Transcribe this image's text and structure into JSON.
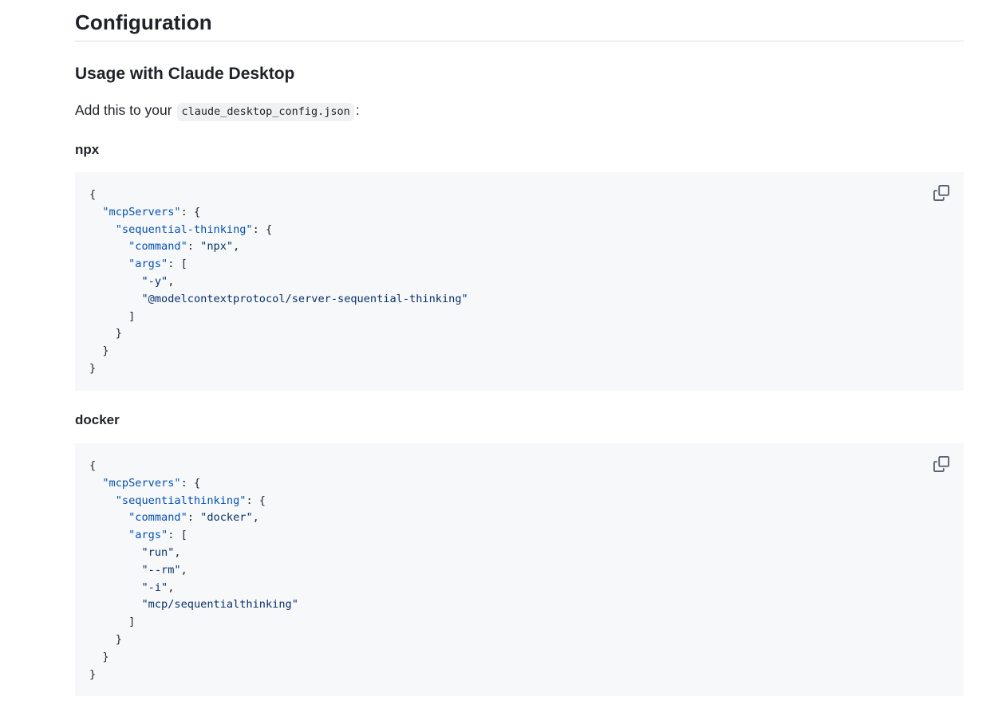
{
  "section": {
    "title": "Configuration"
  },
  "usage": {
    "heading": "Usage with Claude Desktop",
    "intro_prefix": "Add this to your",
    "intro_code": "claude_desktop_config.json",
    "intro_suffix": ":"
  },
  "blocks": [
    {
      "label": "npx",
      "lines": [
        "{",
        "  \"mcpServers\": {",
        "    \"sequential-thinking\": {",
        "      \"command\": \"npx\",",
        "      \"args\": [",
        "        \"-y\",",
        "        \"@modelcontextprotocol/server-sequential-thinking\"",
        "      ]",
        "    }",
        "  }",
        "}"
      ],
      "copy_icon": "copy-icon"
    },
    {
      "label": "docker",
      "lines": [
        "{",
        "  \"mcpServers\": {",
        "    \"sequentialthinking\": {",
        "      \"command\": \"docker\",",
        "      \"args\": [",
        "        \"run\",",
        "        \"--rm\",",
        "        \"-i\",",
        "        \"mcp/sequentialthinking\"",
        "      ]",
        "    }",
        "  }",
        "}"
      ],
      "copy_icon": "copy-icon"
    }
  ],
  "colors": {
    "text": "#1f2328",
    "code_bg": "#f6f8fa",
    "string": "#0a3069",
    "key": "#0550ae",
    "rule": "#d8dee4",
    "icon": "#59636e"
  }
}
